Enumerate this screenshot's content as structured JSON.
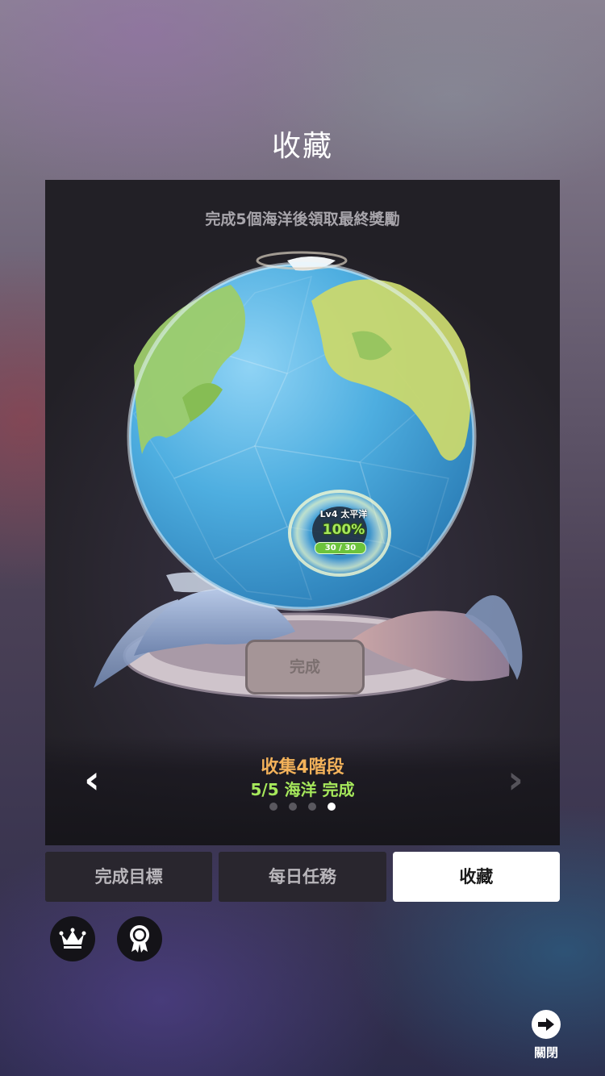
{
  "header": {
    "title": "收藏"
  },
  "panel": {
    "hint": "完成5個海洋後領取最終獎勵",
    "ocean_marker": {
      "level_label": "Lv4 太平洋",
      "percent": "100%",
      "count": "30 / 30"
    },
    "pedestal_label": "完成",
    "stage_title": "收集4階段",
    "stage_subtitle": "5/5 海洋 完成",
    "nav": {
      "prev": "‹",
      "next": "›"
    },
    "pagination": {
      "total": 4,
      "current": 4
    }
  },
  "tabs": [
    {
      "label": "完成目標",
      "active": false
    },
    {
      "label": "每日任務",
      "active": false
    },
    {
      "label": "收藏",
      "active": true
    }
  ],
  "bottom_icons": [
    "crown-icon",
    "medal-icon"
  ],
  "close": {
    "label": "關閉",
    "icon": "arrow-right-icon"
  },
  "colors": {
    "stage_title": "#f3b25a",
    "stage_subtitle": "#a6e85b",
    "tab_active_bg": "#ffffff",
    "tab_bg": "#29262e"
  }
}
